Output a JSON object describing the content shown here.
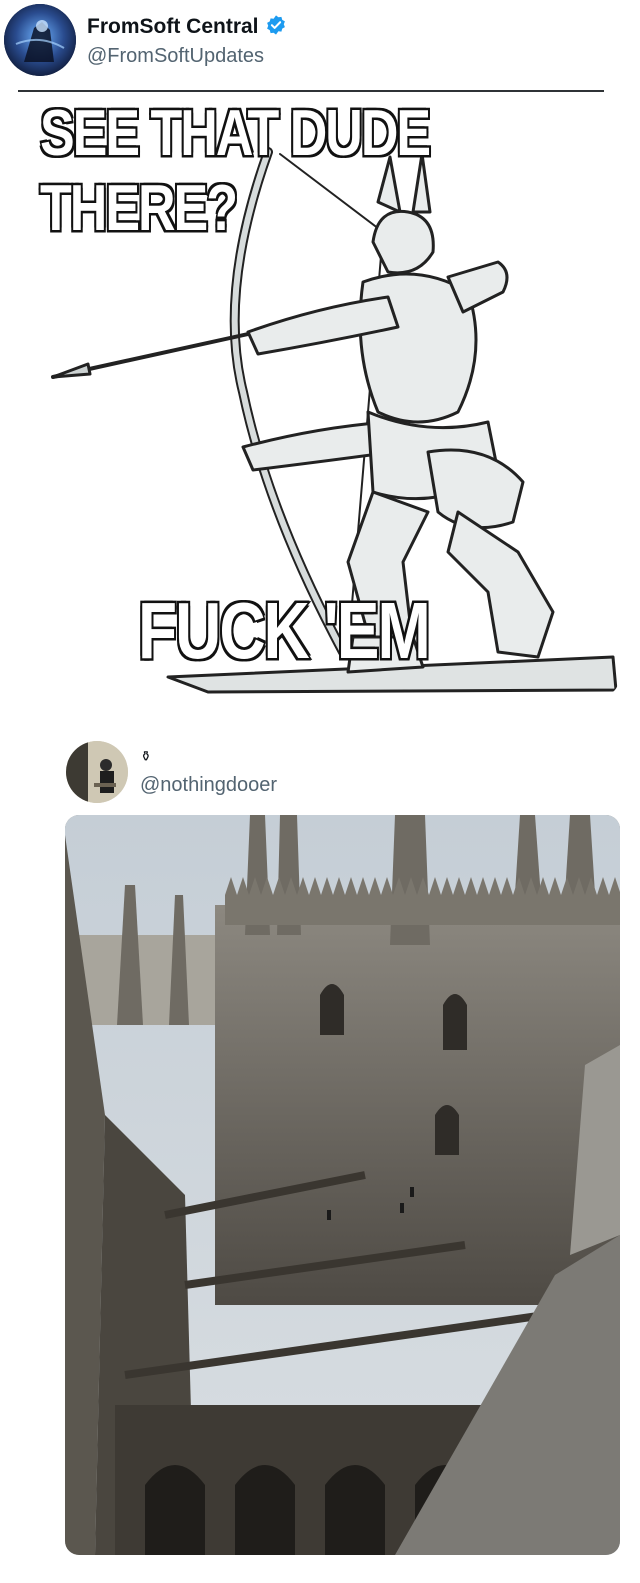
{
  "post": {
    "author_name": "FromSoft Central",
    "author_handle": "@FromSoftUpdates",
    "verified_icon": "verified-badge-icon",
    "accent_color": "#1d9bf0"
  },
  "meme": {
    "top_text": "SEE THAT DUDE THERE?",
    "bottom_text": "FUCK 'EM"
  },
  "reply": {
    "author_name": "⚱",
    "author_handle": "@nothingdooer"
  }
}
